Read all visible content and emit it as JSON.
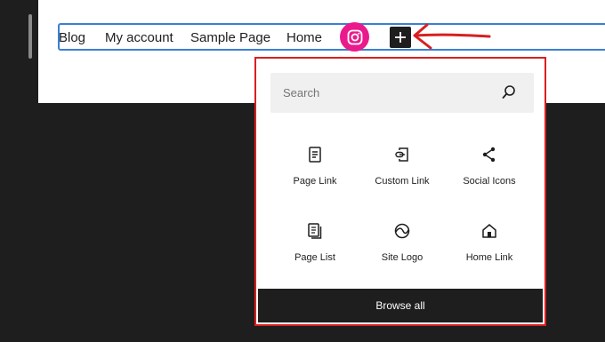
{
  "navigation": {
    "links": [
      {
        "label": "Blog"
      },
      {
        "label": "My account"
      },
      {
        "label": "Sample Page"
      },
      {
        "label": "Home"
      }
    ]
  },
  "colors": {
    "instagram_pink": "#ea1a8c",
    "selection_blue": "#3a7fd5",
    "highlight_red": "#d91f1f",
    "dark": "#1e1e1e"
  },
  "inserter": {
    "search": {
      "placeholder": "Search"
    },
    "blocks": [
      {
        "label": "Page Link",
        "icon": "page-icon"
      },
      {
        "label": "Custom Link",
        "icon": "custom-link-icon"
      },
      {
        "label": "Social Icons",
        "icon": "share-icon"
      },
      {
        "label": "Page List",
        "icon": "page-list-icon"
      },
      {
        "label": "Site Logo",
        "icon": "site-logo-icon"
      },
      {
        "label": "Home Link",
        "icon": "home-icon"
      }
    ],
    "browse_all": "Browse all"
  }
}
